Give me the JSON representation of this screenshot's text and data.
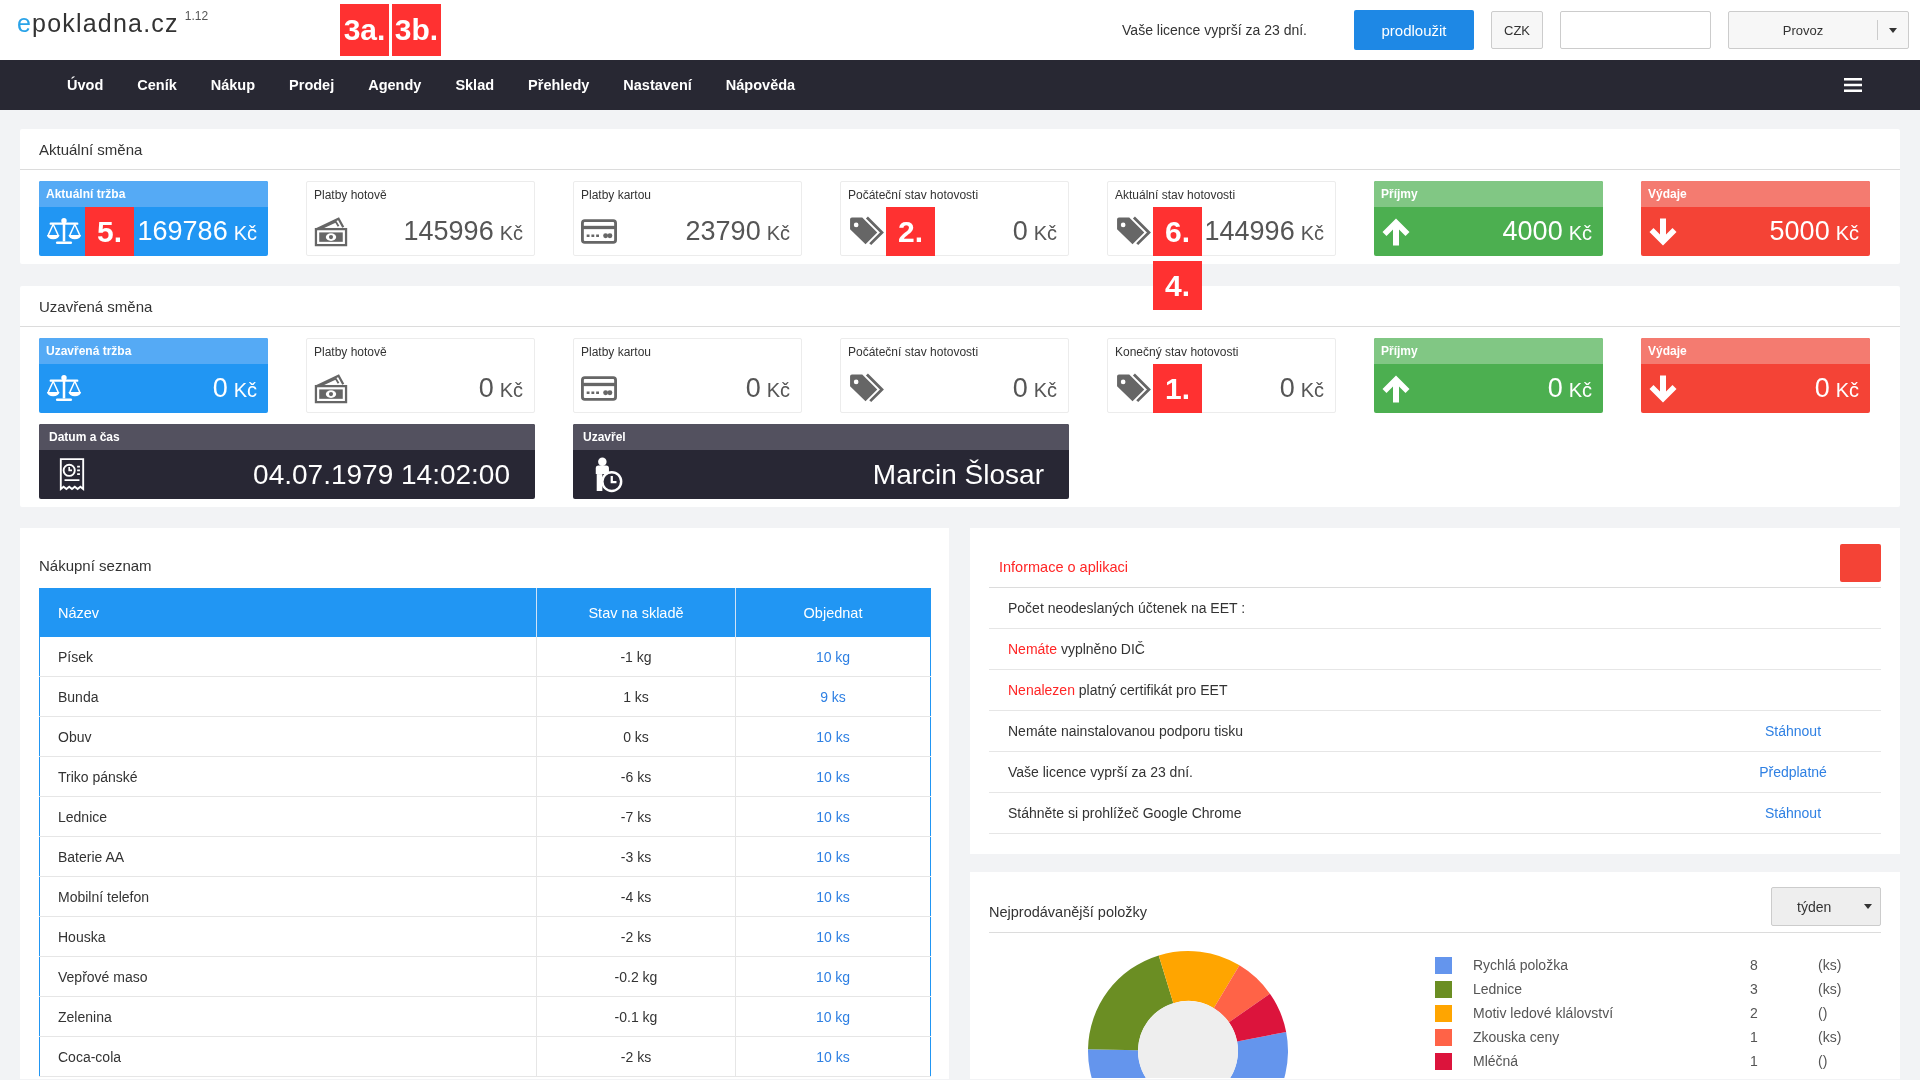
{
  "header": {
    "logo": {
      "accent": "e",
      "name": "pokladna.cz",
      "version": "1.12"
    },
    "markers": [
      "3a.",
      "3b."
    ],
    "license_notice": "Vaše licence vyprší za 23 dní.",
    "renew_button": "prodloužit",
    "currency_button": "CZK",
    "mode_select": "Provoz"
  },
  "nav": {
    "items": [
      "Úvod",
      "Ceník",
      "Nákup",
      "Prodej",
      "Agendy",
      "Sklad",
      "Přehledy",
      "Nastavení",
      "Nápověda"
    ]
  },
  "shifts": [
    {
      "title": "Aktuální směna",
      "cards": [
        {
          "kind": "revenue",
          "label": "Aktuální tržba",
          "value": "169786",
          "unit": "Kč",
          "markers": [
            "5."
          ]
        },
        {
          "kind": "cash",
          "label": "Platby hotově",
          "value": "145996",
          "unit": "Kč"
        },
        {
          "kind": "card",
          "label": "Platby kartou",
          "value": "23790",
          "unit": "Kč"
        },
        {
          "kind": "balance",
          "label": "Počáteční stav hotovosti",
          "value": "0",
          "unit": "Kč",
          "markers": [
            "2."
          ]
        },
        {
          "kind": "balance",
          "label": "Aktuální stav hotovosti",
          "value": "144996",
          "unit": "Kč",
          "markers": [
            "6.",
            "4."
          ]
        },
        {
          "kind": "income",
          "label": "Příjmy",
          "value": "4000",
          "unit": "Kč"
        },
        {
          "kind": "expense",
          "label": "Výdaje",
          "value": "5000",
          "unit": "Kč"
        }
      ]
    },
    {
      "title": "Uzavřená směna",
      "cards": [
        {
          "kind": "revenue",
          "label": "Uzavřená tržba",
          "value": "0",
          "unit": "Kč"
        },
        {
          "kind": "cash",
          "label": "Platby hotově",
          "value": "0",
          "unit": "Kč"
        },
        {
          "kind": "card",
          "label": "Platby kartou",
          "value": "0",
          "unit": "Kč"
        },
        {
          "kind": "balance",
          "label": "Počáteční stav hotovosti",
          "value": "0",
          "unit": "Kč"
        },
        {
          "kind": "balance",
          "label": "Konečný stav hotovosti",
          "value": "0",
          "unit": "Kč",
          "markers": [
            "1."
          ]
        },
        {
          "kind": "income",
          "label": "Příjmy",
          "value": "0",
          "unit": "Kč"
        },
        {
          "kind": "expense",
          "label": "Výdaje",
          "value": "0",
          "unit": "Kč"
        },
        {
          "kind": "datetime",
          "label": "Datum a čas",
          "value": "04.07.1979 14:02:00"
        },
        {
          "kind": "closer",
          "label": "Uzavřel",
          "value": "Marcin Šlosar"
        }
      ]
    }
  ],
  "shopping_list": {
    "title": "Nákupní seznam",
    "columns": [
      "Název",
      "Stav na skladě",
      "Objednat"
    ],
    "rows": [
      {
        "name": "Písek",
        "stock": "-1 kg",
        "order": "10 kg"
      },
      {
        "name": "Bunda",
        "stock": "1 ks",
        "order": "9 ks"
      },
      {
        "name": "Obuv",
        "stock": "0 ks",
        "order": "10 ks"
      },
      {
        "name": "Triko pánské",
        "stock": "-6 ks",
        "order": "10 ks"
      },
      {
        "name": "Lednice",
        "stock": "-7 ks",
        "order": "10 ks"
      },
      {
        "name": "Baterie AA",
        "stock": "-3 ks",
        "order": "10 ks"
      },
      {
        "name": "Mobilní telefon",
        "stock": "-4 ks",
        "order": "10 ks"
      },
      {
        "name": "Houska",
        "stock": "-2 ks",
        "order": "10 ks"
      },
      {
        "name": "Vepřové maso",
        "stock": "-0.2 kg",
        "order": "10 kg"
      },
      {
        "name": "Zelenina",
        "stock": "-0.1 kg",
        "order": "10 kg"
      },
      {
        "name": "Coca-cola",
        "stock": "-2 ks",
        "order": "10 ks"
      }
    ]
  },
  "app_info": {
    "title": "Informace o aplikaci",
    "items": [
      {
        "text": "Počet neodeslaných účtenek na EET :"
      },
      {
        "lead": "Nemáte",
        "text": "vyplněno DIČ"
      },
      {
        "lead": "Nenalezen",
        "text": "platný certifikát pro EET"
      },
      {
        "text": "Nemáte nainstalovanou podporu tisku",
        "action": "Stáhnout"
      },
      {
        "text": "Vaše licence vyprší za 23 dní.",
        "action": "Předplatné"
      },
      {
        "text": "Stáhněte si prohlížeč Google Chrome",
        "action": "Stáhnout"
      }
    ]
  },
  "top_sellers": {
    "title": "Nejprodávanější položky",
    "period_select": "týden",
    "chart_data": {
      "type": "donut",
      "categories": [
        "Rychlá položka",
        "Lednice",
        "Motiv ledové klálovství",
        "Zkouska ceny",
        "Mléčná"
      ],
      "values": [
        53.33,
        20,
        13.33,
        6.67,
        6.67
      ]
    },
    "legend": [
      {
        "count": "8",
        "unit": "(ks)",
        "color": "#6495ed"
      },
      {
        "count": "3",
        "unit": "(ks)",
        "color": "#6b8e23"
      },
      {
        "count": "2",
        "unit": "()",
        "color": "#ffa500"
      },
      {
        "count": "1",
        "unit": "(ks)",
        "color": "#ff6347"
      },
      {
        "count": "1",
        "unit": "()",
        "color": "#dc143c"
      }
    ]
  }
}
